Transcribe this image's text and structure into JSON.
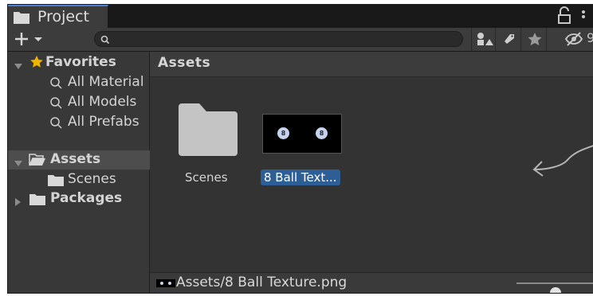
{
  "tab": {
    "title": "Project"
  },
  "toolbar": {
    "search_placeholder": "",
    "hidden_count": "9"
  },
  "tree": {
    "favorites": {
      "label": "Favorites",
      "items": [
        "All Material",
        "All Models",
        "All Prefabs"
      ]
    },
    "assets": {
      "label": "Assets",
      "children": [
        "Scenes"
      ]
    },
    "packages": {
      "label": "Packages"
    }
  },
  "content": {
    "header": "Assets",
    "items": [
      {
        "name": "Scenes",
        "kind": "folder"
      },
      {
        "name": "8 Ball Text...",
        "kind": "texture",
        "ball_number": "8"
      }
    ]
  },
  "status": {
    "path": "Assets/8 Ball Texture.png",
    "zoom_level": 0.5
  },
  "colors": {
    "accent": "#4c7fd6",
    "selection": "#2d5f96",
    "favorite_star": "#f0b400"
  }
}
